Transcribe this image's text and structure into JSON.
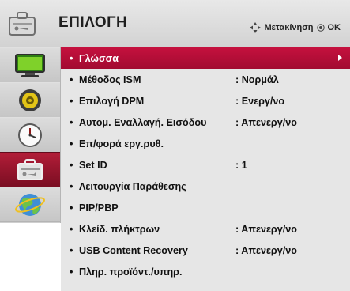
{
  "header": {
    "title": "ΕΠΙΛΟΓΗ",
    "move_hint": "Μετακίνηση",
    "ok_hint": "OK",
    "icon": "toolbox-icon"
  },
  "sidebar": {
    "items": [
      {
        "name": "picture",
        "icon": "tv-screen-icon"
      },
      {
        "name": "audio",
        "icon": "speaker-icon"
      },
      {
        "name": "time",
        "icon": "clock-icon"
      },
      {
        "name": "option",
        "icon": "toolbox-icon",
        "active": true
      },
      {
        "name": "network",
        "icon": "globe-icon"
      }
    ]
  },
  "menu": {
    "items": [
      {
        "label": "Γλώσσα",
        "value": "",
        "selected": true
      },
      {
        "label": "Μέθοδος ISM",
        "value": ": Νορμάλ"
      },
      {
        "label": "Επιλογή DPM",
        "value": ": Ενεργ/νο"
      },
      {
        "label": "Αυτομ. Εναλλαγή. Εισόδου",
        "value": ": Απενεργ/νο"
      },
      {
        "label": "Επ/φορά εργ.ρυθ.",
        "value": ""
      },
      {
        "label": "Set ID",
        "value": ": 1"
      },
      {
        "label": "Λειτουργία Παράθεσης",
        "value": ""
      },
      {
        "label": "PIP/PBP",
        "value": ""
      },
      {
        "label": "Κλείδ. πλήκτρων",
        "value": ": Απενεργ/νο"
      },
      {
        "label": "USB Content Recovery",
        "value": ": Απενεργ/νο"
      },
      {
        "label": "Πληρ. προϊόντ./υπηρ.",
        "value": ""
      }
    ]
  },
  "colors": {
    "accent": "#b0113b",
    "sidebar_active": "#9a1229",
    "content_bg": "#e6e6e6"
  }
}
